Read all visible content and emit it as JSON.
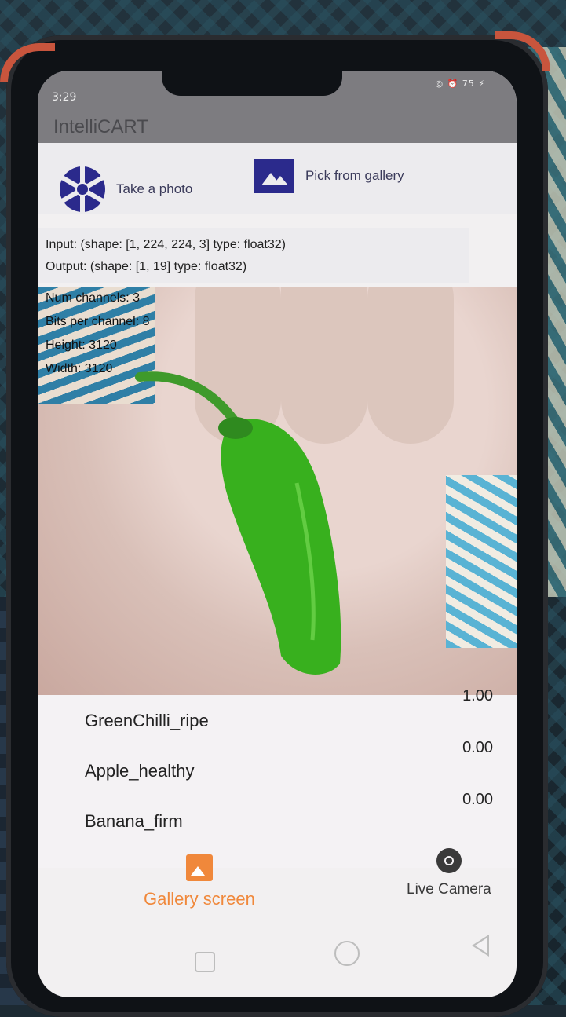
{
  "status_bar": {
    "time": "3:29",
    "icons_right": "◎ ⏰ 75 ⚡"
  },
  "app": {
    "title": "IntelliCART"
  },
  "actions": {
    "take_photo_label": "Take a photo",
    "pick_gallery_label": "Pick from gallery"
  },
  "model_info": {
    "input": "Input: (shape: [1, 224, 224, 3] type: float32)",
    "output": "Output: (shape: [1, 19] type: float32)"
  },
  "image_info": {
    "num_channels": "Num channels: 3",
    "bits_per_channel": "Bits per channel: 8",
    "height": "Height: 3120",
    "width": "Width: 3120"
  },
  "results": [
    {
      "label": "GreenChilli_ripe",
      "value": "1.00"
    },
    {
      "label": "Apple_healthy",
      "value": "0.00"
    },
    {
      "label": "Banana_firm",
      "value": "0.00"
    }
  ],
  "bottom_nav": {
    "gallery_label": "Gallery screen",
    "live_label": "Live Camera",
    "active_color": "#f0883b"
  },
  "colors": {
    "primary": "#2b2a8c",
    "appbar": "#7d7c80"
  }
}
